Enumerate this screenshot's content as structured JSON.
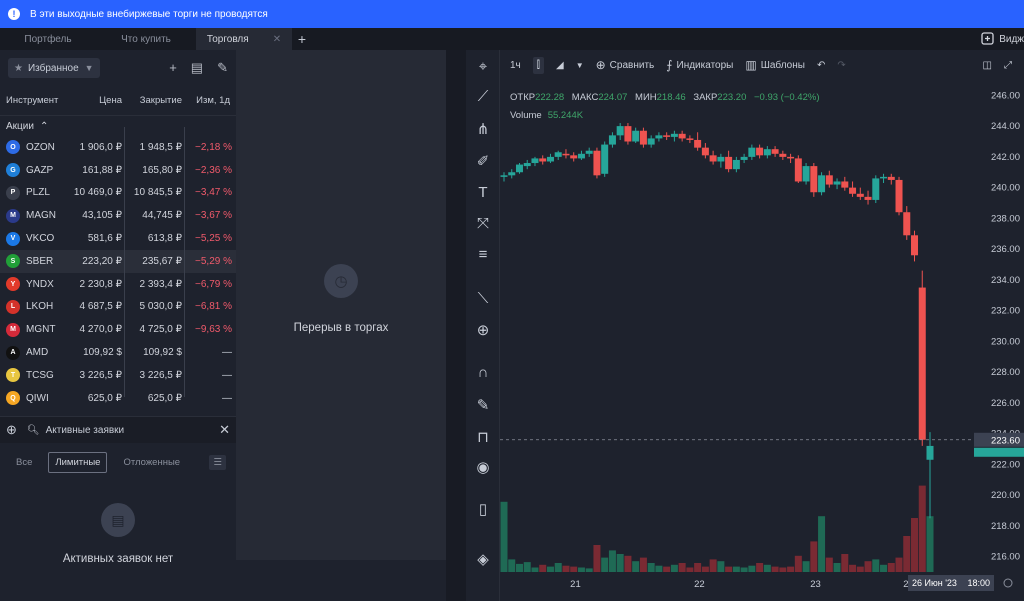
{
  "banner": {
    "text": "В эти выходные внебиржевые торги не проводятся"
  },
  "tabs": [
    {
      "label": "Портфель"
    },
    {
      "label": "Что купить"
    },
    {
      "label": "Торговля"
    }
  ],
  "widget_label": "Видж",
  "watchlist": {
    "favorites_label": "Избранное",
    "columns": {
      "instrument": "Инструмент",
      "price": "Цена",
      "close": "Закрытие",
      "change": "Изм, 1д"
    },
    "section": "Акции",
    "rows": [
      {
        "ticker": "OZON",
        "price": "1 906,0 ₽",
        "close": "1 948,5 ₽",
        "change": "−2,18 %",
        "color": "#2d6be6"
      },
      {
        "ticker": "GAZP",
        "price": "161,88 ₽",
        "close": "165,80 ₽",
        "change": "−2,36 %",
        "color": "#1f7fd8"
      },
      {
        "ticker": "PLZL",
        "price": "10 469,0 ₽",
        "close": "10 845,5 ₽",
        "change": "−3,47 %",
        "color": "#3a3f4c"
      },
      {
        "ticker": "MAGN",
        "price": "43,105 ₽",
        "close": "44,745 ₽",
        "change": "−3,67 %",
        "color": "#2b3a8a"
      },
      {
        "ticker": "VKCO",
        "price": "581,6 ₽",
        "close": "613,8 ₽",
        "change": "−5,25 %",
        "color": "#1b78e6"
      },
      {
        "ticker": "SBER",
        "price": "223,20 ₽",
        "close": "235,67 ₽",
        "change": "−5,29 %",
        "color": "#21a038"
      },
      {
        "ticker": "YNDX",
        "price": "2 230,8 ₽",
        "close": "2 393,4 ₽",
        "change": "−6,79 %",
        "color": "#e23a2a"
      },
      {
        "ticker": "LKOH",
        "price": "4 687,5 ₽",
        "close": "5 030,0 ₽",
        "change": "−6,81 %",
        "color": "#d4322a"
      },
      {
        "ticker": "MGNT",
        "price": "4 270,0 ₽",
        "close": "4 725,0 ₽",
        "change": "−9,63 %",
        "color": "#d42a3a"
      },
      {
        "ticker": "AMD",
        "price": "109,92 $",
        "close": "109,92 $",
        "change": "—",
        "color": "#111111"
      },
      {
        "ticker": "TCSG",
        "price": "3 226,5 ₽",
        "close": "3 226,5 ₽",
        "change": "—",
        "color": "#e8c640"
      },
      {
        "ticker": "QIWI",
        "price": "625,0 ₽",
        "close": "625,0 ₽",
        "change": "—",
        "color": "#f5a623"
      }
    ]
  },
  "orders": {
    "title": "Активные заявки",
    "tabs": [
      "Все",
      "Лимитные",
      "Отложенные"
    ],
    "empty_text": "Активных заявок нет"
  },
  "middle": {
    "text": "Перерыв в торгах"
  },
  "chart_toolbar": {
    "interval": "1ч",
    "compare": "Сравнить",
    "indicators": "Индикаторы",
    "templates": "Шаблоны"
  },
  "legend": {
    "open_label": "ОТКР",
    "open": "222.28",
    "high_label": "МАКС",
    "high": "224.07",
    "low_label": "МИН",
    "low": "218.46",
    "close_label": "ЗАКР",
    "close": "223.20",
    "change": "−0.93 (−0.42%)",
    "volume_label": "Volume",
    "volume": "55.244K"
  },
  "chart_data": {
    "type": "candlestick",
    "price_axis_ticks": [
      "246.00",
      "244.00",
      "242.00",
      "240.00",
      "238.00",
      "236.00",
      "234.00",
      "232.00",
      "230.00",
      "228.00",
      "226.00",
      "224.00",
      "222.00",
      "220.00",
      "218.00",
      "216.00"
    ],
    "ylim": [
      215,
      247
    ],
    "date_ticks": [
      "21",
      "22",
      "23",
      "24"
    ],
    "current_price_label": "223.60",
    "crosshair_date": "26 Июн '23",
    "crosshair_time": "18:00",
    "up_color": "#26a69a",
    "down_color": "#ef5350",
    "candles": [
      [
        240.7,
        241.0,
        240.4,
        240.8
      ],
      [
        240.8,
        241.2,
        240.6,
        241.0
      ],
      [
        241.0,
        241.6,
        240.9,
        241.5
      ],
      [
        241.4,
        241.8,
        241.2,
        241.6
      ],
      [
        241.6,
        242.0,
        241.4,
        241.9
      ],
      [
        241.9,
        242.1,
        241.5,
        241.7
      ],
      [
        241.7,
        242.2,
        241.6,
        242.0
      ],
      [
        242.0,
        242.4,
        241.8,
        242.3
      ],
      [
        242.2,
        242.5,
        241.9,
        242.1
      ],
      [
        242.1,
        242.3,
        241.7,
        241.9
      ],
      [
        241.9,
        242.4,
        241.8,
        242.2
      ],
      [
        242.2,
        242.6,
        242.0,
        242.4
      ],
      [
        242.4,
        242.6,
        240.6,
        240.8
      ],
      [
        240.9,
        243.0,
        240.7,
        242.8
      ],
      [
        242.8,
        243.6,
        242.6,
        243.4
      ],
      [
        243.4,
        244.2,
        243.1,
        244.0
      ],
      [
        244.0,
        244.2,
        242.8,
        243.0
      ],
      [
        243.0,
        243.9,
        242.9,
        243.7
      ],
      [
        243.7,
        243.9,
        242.6,
        242.8
      ],
      [
        242.8,
        243.4,
        242.6,
        243.2
      ],
      [
        243.2,
        243.6,
        243.0,
        243.4
      ],
      [
        243.4,
        243.6,
        243.1,
        243.3
      ],
      [
        243.3,
        243.7,
        243.0,
        243.5
      ],
      [
        243.5,
        243.7,
        243.0,
        243.2
      ],
      [
        243.2,
        243.4,
        242.9,
        243.1
      ],
      [
        243.1,
        243.6,
        242.4,
        242.6
      ],
      [
        242.6,
        242.9,
        241.9,
        242.1
      ],
      [
        242.1,
        242.4,
        241.5,
        241.7
      ],
      [
        241.7,
        242.2,
        241.3,
        242.0
      ],
      [
        242.0,
        242.4,
        241.0,
        241.2
      ],
      [
        241.2,
        242.0,
        241.0,
        241.8
      ],
      [
        241.8,
        242.2,
        241.6,
        242.0
      ],
      [
        242.0,
        242.8,
        241.8,
        242.6
      ],
      [
        242.6,
        242.8,
        241.9,
        242.1
      ],
      [
        242.1,
        242.7,
        241.9,
        242.5
      ],
      [
        242.5,
        242.7,
        242.0,
        242.2
      ],
      [
        242.2,
        242.4,
        241.8,
        242.0
      ],
      [
        242.0,
        242.2,
        241.6,
        241.9
      ],
      [
        241.9,
        242.1,
        240.3,
        240.4
      ],
      [
        240.4,
        241.6,
        240.2,
        241.4
      ],
      [
        241.4,
        241.6,
        239.4,
        239.7
      ],
      [
        239.7,
        241.0,
        239.5,
        240.8
      ],
      [
        240.8,
        241.1,
        240.0,
        240.2
      ],
      [
        240.2,
        240.6,
        239.9,
        240.4
      ],
      [
        240.4,
        240.7,
        239.8,
        240.0
      ],
      [
        240.0,
        240.4,
        239.4,
        239.6
      ],
      [
        239.6,
        240.0,
        239.2,
        239.4
      ],
      [
        239.4,
        239.8,
        238.9,
        239.2
      ],
      [
        239.2,
        240.8,
        239.0,
        240.6
      ],
      [
        240.6,
        240.9,
        240.3,
        240.7
      ],
      [
        240.7,
        240.9,
        240.2,
        240.5
      ],
      [
        240.5,
        240.7,
        238.2,
        238.4
      ],
      [
        238.4,
        238.8,
        236.6,
        236.9
      ],
      [
        236.9,
        237.2,
        235.2,
        235.6
      ],
      [
        233.5,
        234.6,
        223.2,
        223.6
      ],
      [
        222.3,
        224.1,
        218.5,
        223.2
      ]
    ],
    "volume_fraction": [
      0.78,
      0.14,
      0.09,
      0.11,
      0.05,
      0.08,
      0.06,
      0.1,
      0.07,
      0.06,
      0.05,
      0.04,
      0.3,
      0.16,
      0.24,
      0.2,
      0.18,
      0.12,
      0.16,
      0.1,
      0.07,
      0.06,
      0.08,
      0.1,
      0.05,
      0.1,
      0.06,
      0.14,
      0.12,
      0.06,
      0.06,
      0.05,
      0.07,
      0.1,
      0.08,
      0.06,
      0.05,
      0.06,
      0.18,
      0.12,
      0.34,
      0.62,
      0.16,
      0.1,
      0.2,
      0.08,
      0.06,
      0.12,
      0.14,
      0.08,
      0.1,
      0.16,
      0.4,
      0.6,
      0.96,
      0.62
    ]
  }
}
